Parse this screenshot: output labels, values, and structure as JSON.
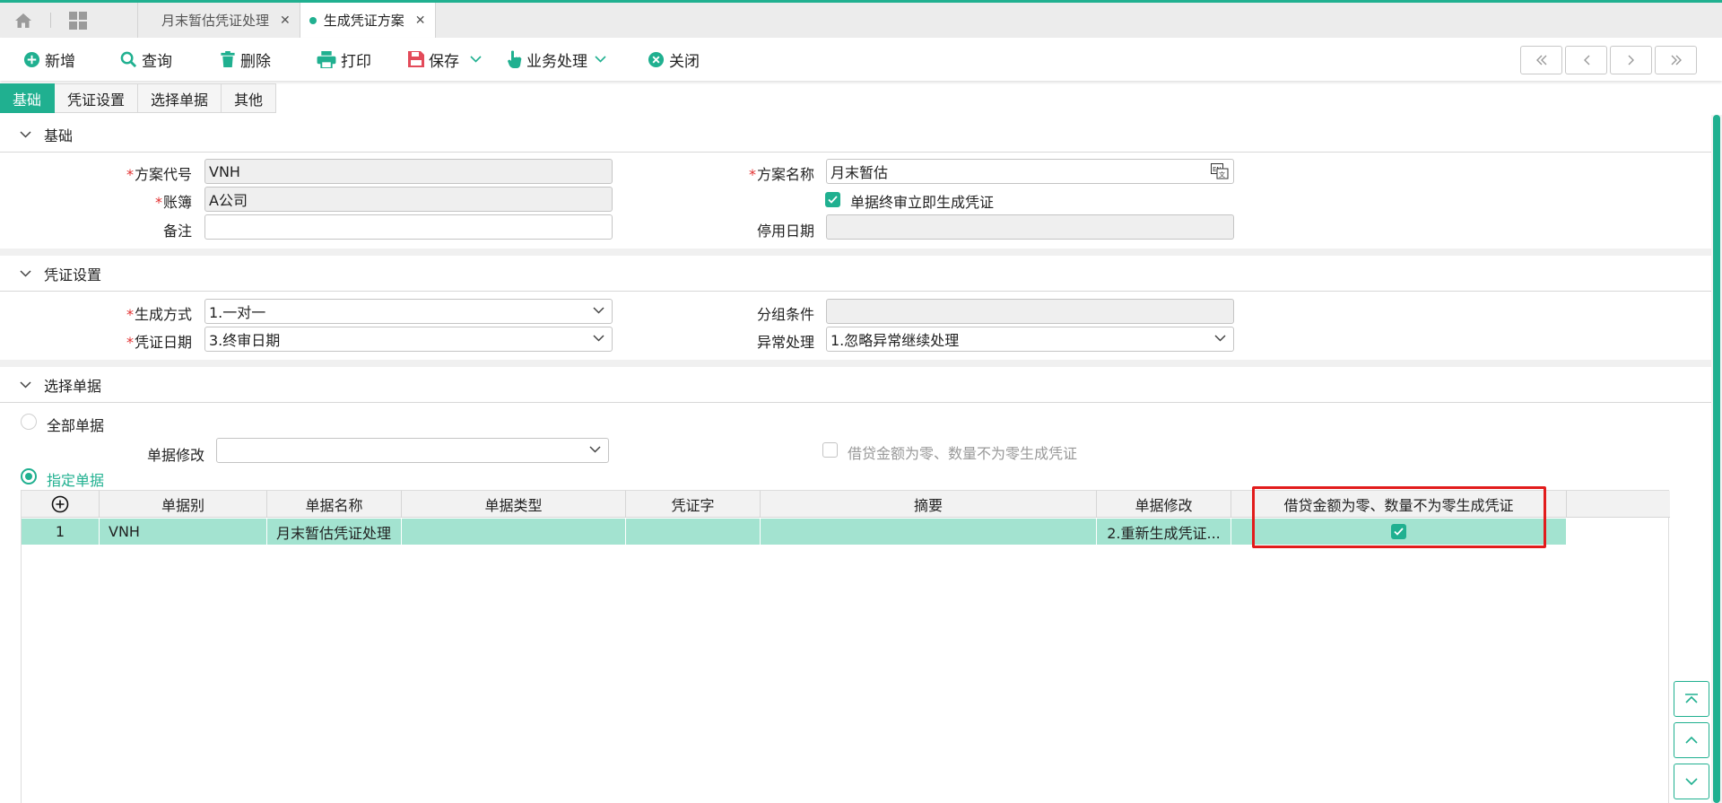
{
  "tabs": [
    {
      "label": "月末暂估凭证处理",
      "active": false
    },
    {
      "label": "生成凭证方案",
      "active": true
    }
  ],
  "toolbar": {
    "add": "新增",
    "query": "查询",
    "delete": "删除",
    "print": "打印",
    "save": "保存",
    "business": "业务处理",
    "close": "关闭"
  },
  "subtabs": [
    "基础",
    "凭证设置",
    "选择单据",
    "其他"
  ],
  "sections": {
    "basic": "基础",
    "voucher": "凭证设置",
    "select": "选择单据"
  },
  "basic": {
    "code_label": "方案代号",
    "code_value": "VNH",
    "name_label": "方案名称",
    "name_value": "月末暂估",
    "book_label": "账簿",
    "book_value": "A公司",
    "auto_label": "单据终审立即生成凭证",
    "auto_checked": true,
    "remark_label": "备注",
    "remark_value": "",
    "stop_label": "停用日期",
    "stop_value": ""
  },
  "voucher": {
    "mode_label": "生成方式",
    "mode_value": "1.一对一",
    "group_label": "分组条件",
    "group_value": "",
    "date_label": "凭证日期",
    "date_value": "3.终审日期",
    "error_label": "异常处理",
    "error_value": "1.忽略异常继续处理"
  },
  "select": {
    "all_label": "全部单据",
    "modify_label": "单据修改",
    "modify_value": "",
    "zero_label": "借贷金额为零、数量不为零生成凭证",
    "specific_label": "指定单据",
    "selected": "specific"
  },
  "grid": {
    "columns": [
      "单据别",
      "单据名称",
      "单据类型",
      "凭证字",
      "摘要",
      "单据修改",
      "借贷金额为零、数量不为零生成凭证"
    ],
    "rows": [
      {
        "no": "1",
        "code": "VNH",
        "name": "月末暂估凭证处理",
        "type": "",
        "word": "",
        "summary": "",
        "modify": "2.重新生成凭证...",
        "zero": true
      }
    ]
  },
  "colors": {
    "accent": "#20b090",
    "highlight": "#e21c1c"
  }
}
